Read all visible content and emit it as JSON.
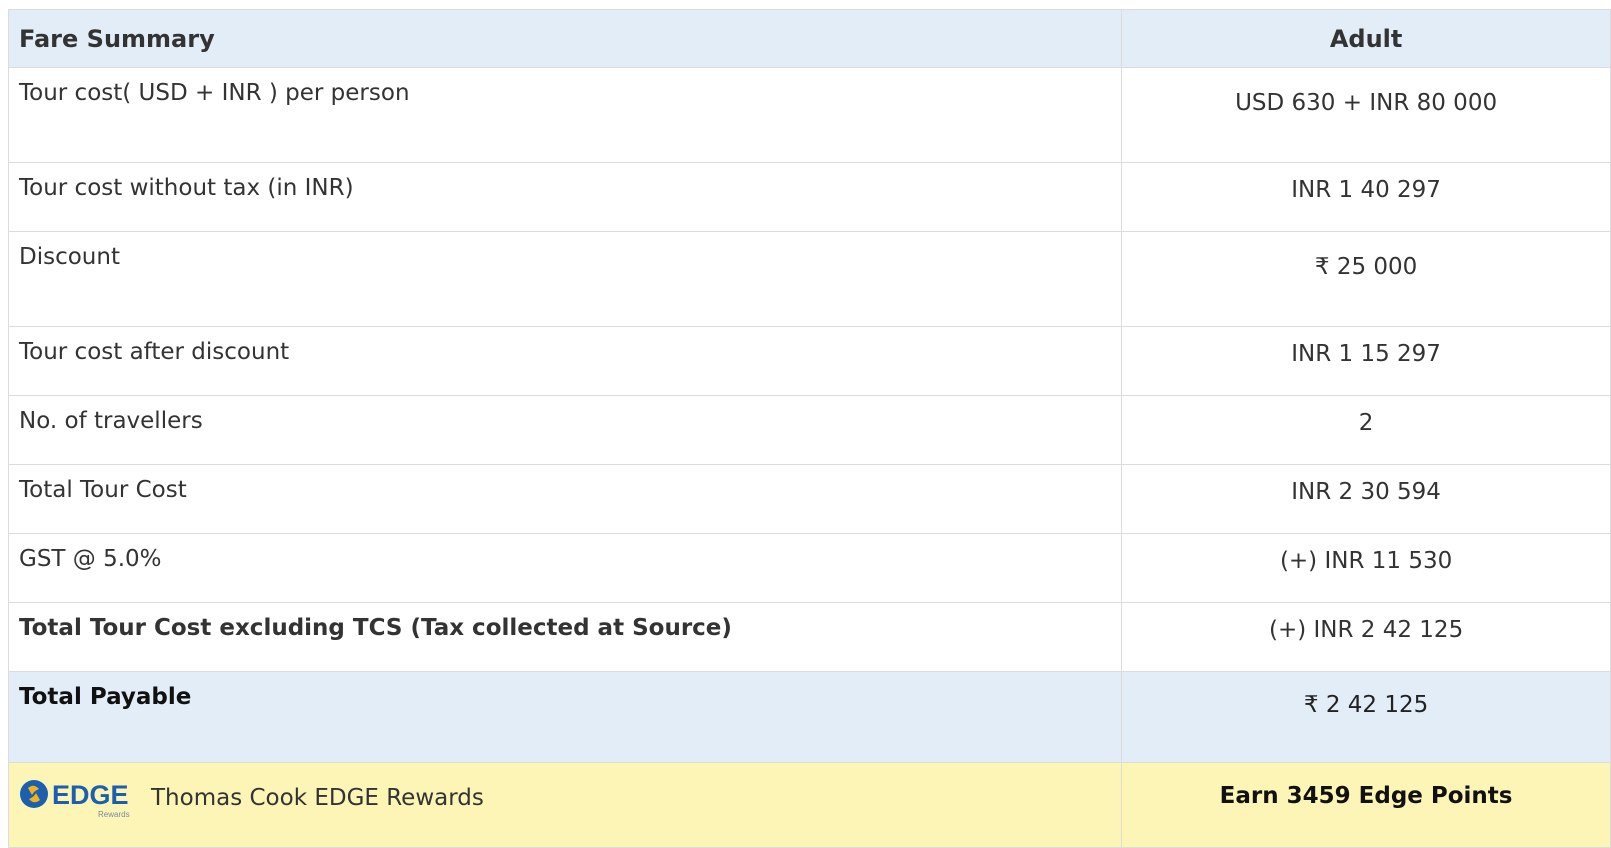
{
  "header": {
    "title": "Fare Summary",
    "column": "Adult"
  },
  "rows": [
    {
      "label": "Tour cost( USD + INR ) per person",
      "value": "USD 630 + INR 80 000"
    },
    {
      "label": "Tour cost without tax (in INR)",
      "value": "INR 1 40 297"
    },
    {
      "label": "Discount",
      "value": "₹ 25 000"
    },
    {
      "label": "Tour cost after discount",
      "value": "INR 1 15 297"
    },
    {
      "label": "No. of travellers",
      "value": "2"
    },
    {
      "label": "Total Tour Cost",
      "value": "INR 2 30 594"
    },
    {
      "label": "GST @ 5.0%",
      "value": "(+) INR 11 530"
    },
    {
      "label": "Total Tour Cost excluding TCS (Tax collected at Source)",
      "value": "(+) INR 2 42 125"
    }
  ],
  "payable": {
    "label": "Total Payable",
    "value": "₹ 2 42 125"
  },
  "rewards": {
    "logo_text": "EDGE",
    "logo_subtext": "Rewards",
    "label": "Thomas Cook EDGE Rewards",
    "value": "Earn 3459 Edge Points"
  },
  "colors": {
    "header_bg": "#e3edf8",
    "rewards_bg": "#fdf5b5",
    "logo_blue": "#1c5fb0",
    "logo_yellow": "#f2b21b"
  }
}
